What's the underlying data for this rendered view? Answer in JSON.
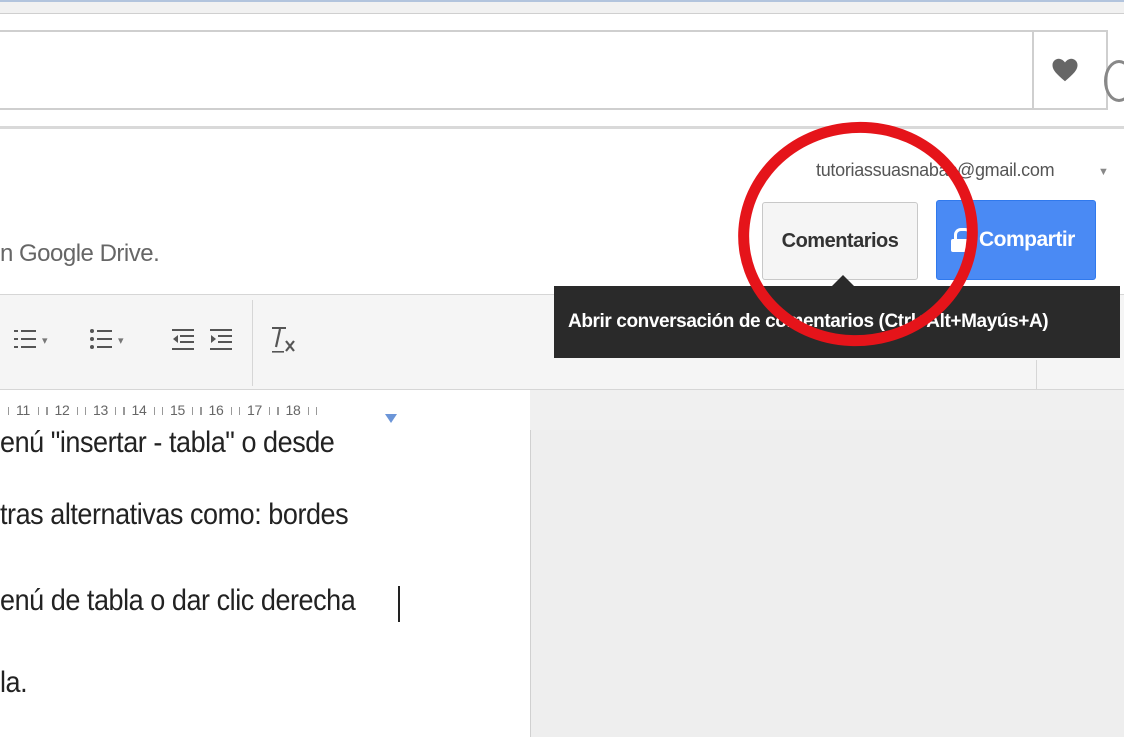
{
  "header": {
    "account_email": "tutoriassuasnabas@gmail.com",
    "doc_subtitle": "n Google Drive."
  },
  "buttons": {
    "comments_label": "Comentarios",
    "share_label": "Compartir"
  },
  "tooltip": {
    "text": "Abrir conversación de comentarios (Ctrl+Alt+Mayús+A)"
  },
  "ruler": {
    "numbers": [
      "11",
      "12",
      "13",
      "14",
      "15",
      "16",
      "17",
      "18"
    ]
  },
  "document": {
    "lines": [
      "enú \"insertar - tabla\" o desde",
      "tras alternativas como: bordes",
      "enú de tabla o dar clic derecha",
      "la."
    ]
  },
  "icons": {
    "favorite": "heart-icon",
    "numbered_list": "numbered-list-icon",
    "bulleted_list": "bulleted-list-icon",
    "decrease_indent": "decrease-indent-icon",
    "increase_indent": "increase-indent-icon",
    "clear_formatting": "clear-formatting-icon",
    "lock": "lock-icon"
  },
  "colors": {
    "share_button": "#4a8af4",
    "tooltip_bg": "#2a2a2a",
    "annotation": "#e5141a"
  }
}
